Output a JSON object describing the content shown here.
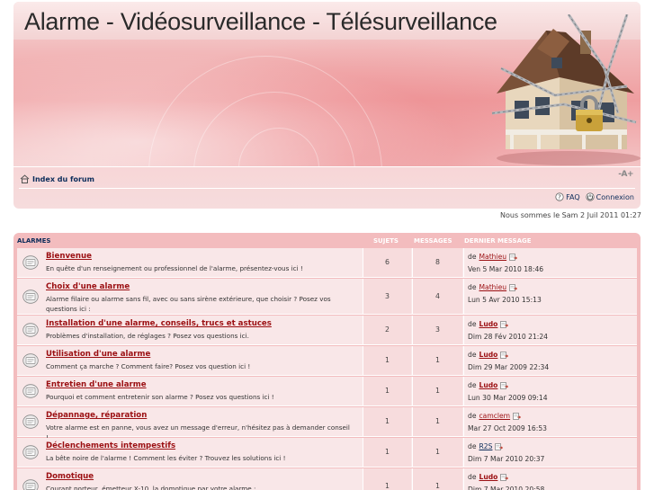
{
  "header": {
    "site_title": "Alarme - Vidéosurveillance - Télésurveillance"
  },
  "nav": {
    "home_label": "Index du forum",
    "font_size_label": "-A+",
    "faq_label": "FAQ",
    "login_label": "Connexion"
  },
  "date_line": "Nous sommes le Sam 2 Juil 2011 01:27",
  "table": {
    "category": "ALARMES",
    "col_topics": "SUJETS",
    "col_posts": "MESSAGES",
    "col_last": "DERNIER MESSAGE"
  },
  "forums": [
    {
      "title": "Bienvenue",
      "description": "En quête d'un renseignement ou professionnel de l'alarme, présentez-vous ici !",
      "topics": "6",
      "posts": "8",
      "last_by": "de",
      "last_author": "Mathieu",
      "last_date": "Ven 5 Mar 2010 18:46"
    },
    {
      "title": "Choix d'une alarme",
      "description": "Alarme filaire ou alarme sans fil, avec ou sans sirène extérieure, que choisir ? Posez vos questions ici :",
      "topics": "3",
      "posts": "4",
      "last_by": "de",
      "last_author": "Mathieu",
      "last_date": "Lun 5 Avr 2010 15:13"
    },
    {
      "title": "Installation d'une alarme, conseils, trucs et astuces",
      "description": "Problèmes d'installation, de réglages ? Posez vos questions ici.",
      "topics": "2",
      "posts": "3",
      "last_by": "de",
      "last_author": "Ludo",
      "last_date": "Dim 28 Fév 2010 21:24"
    },
    {
      "title": "Utilisation d'une alarme",
      "description": "Comment ça marche ? Comment faire? Posez vos question ici !",
      "topics": "1",
      "posts": "1",
      "last_by": "de",
      "last_author": "Ludo",
      "last_date": "Dim 29 Mar 2009 22:34"
    },
    {
      "title": "Entretien d'une alarme",
      "description": "Pourquoi et comment entretenir son alarme ? Posez vos questions ici !",
      "topics": "1",
      "posts": "1",
      "last_by": "de",
      "last_author": "Ludo",
      "last_date": "Lun 30 Mar 2009 09:14"
    },
    {
      "title": "Dépannage, réparation",
      "description": "Votre alarme est en panne, vous avez un message d'erreur, n'hésitez pas à demander conseil !",
      "topics": "1",
      "posts": "1",
      "last_by": "de",
      "last_author": "camclem",
      "last_date": "Mar 27 Oct 2009 16:53"
    },
    {
      "title": "Déclenchements intempestifs",
      "description": "La bête noire de l'alarme ! Comment les éviter ? Trouvez les solutions ici !",
      "topics": "1",
      "posts": "1",
      "last_by": "de",
      "last_author": "R2S",
      "last_date": "Dim 7 Mar 2010 20:37"
    },
    {
      "title": "Domotique",
      "description": "Courant porteur, émetteur X-10, la domotique par votre alarme :",
      "topics": "1",
      "posts": "1",
      "last_by": "de",
      "last_author": "Ludo",
      "last_date": "Dim 7 Mar 2010 20:58"
    }
  ],
  "colors": {
    "forum_title": "#9b0f12",
    "link_navy": "#0b2c5a",
    "header_bg": "#f3bcbe",
    "row_bg": "#f9e7e8"
  }
}
